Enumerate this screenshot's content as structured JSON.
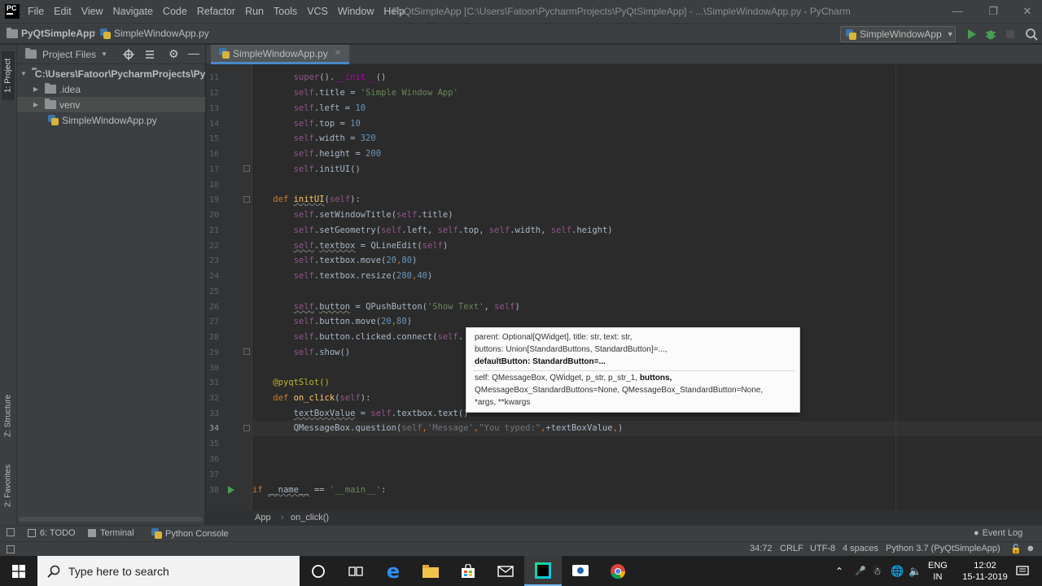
{
  "menubar": {
    "logo": "PC",
    "items": [
      "File",
      "Edit",
      "View",
      "Navigate",
      "Code",
      "Refactor",
      "Run",
      "Tools",
      "VCS",
      "Window",
      "Help"
    ],
    "window_title": "PyQtSimpleApp [C:\\Users\\Fatoor\\PycharmProjects\\PyQtSimpleApp] - ...\\SimpleWindowApp.py - PyCharm"
  },
  "navbar": {
    "project": "PyQtSimpleApp",
    "file": "SimpleWindowApp.py",
    "run_config": "SimpleWindowApp"
  },
  "left_strip": {
    "project_tab": "1: Project",
    "structure_tab": "Z: Structure",
    "favorites_tab": "2: Favorites"
  },
  "project_panel": {
    "title": "Project Files",
    "tree": [
      {
        "label": "C:\\Users\\Fatoor\\PycharmProjects\\PyQ",
        "type": "folder",
        "expanded": true
      },
      {
        "label": ".idea",
        "type": "folder",
        "expanded": false
      },
      {
        "label": "venv",
        "type": "folder",
        "expanded": false
      },
      {
        "label": "SimpleWindowApp.py",
        "type": "python-file"
      }
    ]
  },
  "editor": {
    "tab": "SimpleWindowApp.py",
    "line_numbers": [
      "11",
      "12",
      "13",
      "14",
      "15",
      "16",
      "17",
      "18",
      "19",
      "20",
      "21",
      "22",
      "23",
      "24",
      "25",
      "26",
      "27",
      "28",
      "29",
      "30",
      "31",
      "32",
      "33",
      "34",
      "35",
      "36",
      "37",
      "38"
    ],
    "lines": [
      "        super().__init__()",
      "        self.title = 'Simple Window App'",
      "        self.left = 10",
      "        self.top = 10",
      "        self.width = 320",
      "        self.height = 200",
      "        self.initUI()",
      "",
      "    def initUI(self):",
      "        self.setWindowTitle(self.title)",
      "        self.setGeometry(self.left, self.top, self.width, self.height)",
      "        self.textbox = QLineEdit(self)",
      "        self.textbox.move(20,80)",
      "        self.textbox.resize(280,40)",
      "",
      "        self.button = QPushButton('Show Text', self)",
      "        self.button.move(20,80)",
      "        self.button.clicked.connect(self.",
      "        self.show()",
      "",
      "    @pyqtSlot()",
      "    def on_click(self):",
      "        textBoxValue = self.textbox.text()",
      "        QMessageBox.question(self,'Message',\"You typed:\",+textBoxValue,)",
      "",
      "",
      "",
      "if __name__ == '__main__':"
    ],
    "cursor_position": "34:72"
  },
  "tooltip": {
    "line1": "parent: Optional[QWidget], title: str, text: str,",
    "line2": "buttons: Union[StandardButtons, StandardButton]=...,",
    "line3": "defaultButton: StandardButton=...",
    "line4_a": "self: QMessageBox, QWidget, p_str, p_str_1, ",
    "line4_b": "buttons,",
    "line5": "QMessageBox_StandardButtons=None, QMessageBox_StandardButton=None,",
    "line6": "*args, **kwargs"
  },
  "editor_breadcrumb": {
    "class": "App",
    "method": "on_click()"
  },
  "bottom_tabs": {
    "todo": "6: TODO",
    "terminal": "Terminal",
    "python_console": "Python Console",
    "event_log": "Event Log"
  },
  "status_bar": {
    "position": "34:72",
    "line_sep": "CRLF",
    "encoding": "UTF-8",
    "indent": "4 spaces",
    "interpreter": "Python 3.7 (PyQtSimpleApp)"
  },
  "taskbar": {
    "search_placeholder": "Type here to search",
    "language": "ENG",
    "region": "IN",
    "time": "12:02",
    "date": "15-11-2019"
  },
  "colors": {
    "accent_blue": "#4a88c7",
    "run_green": "#499c54",
    "editor_bg": "#2b2b2b"
  }
}
